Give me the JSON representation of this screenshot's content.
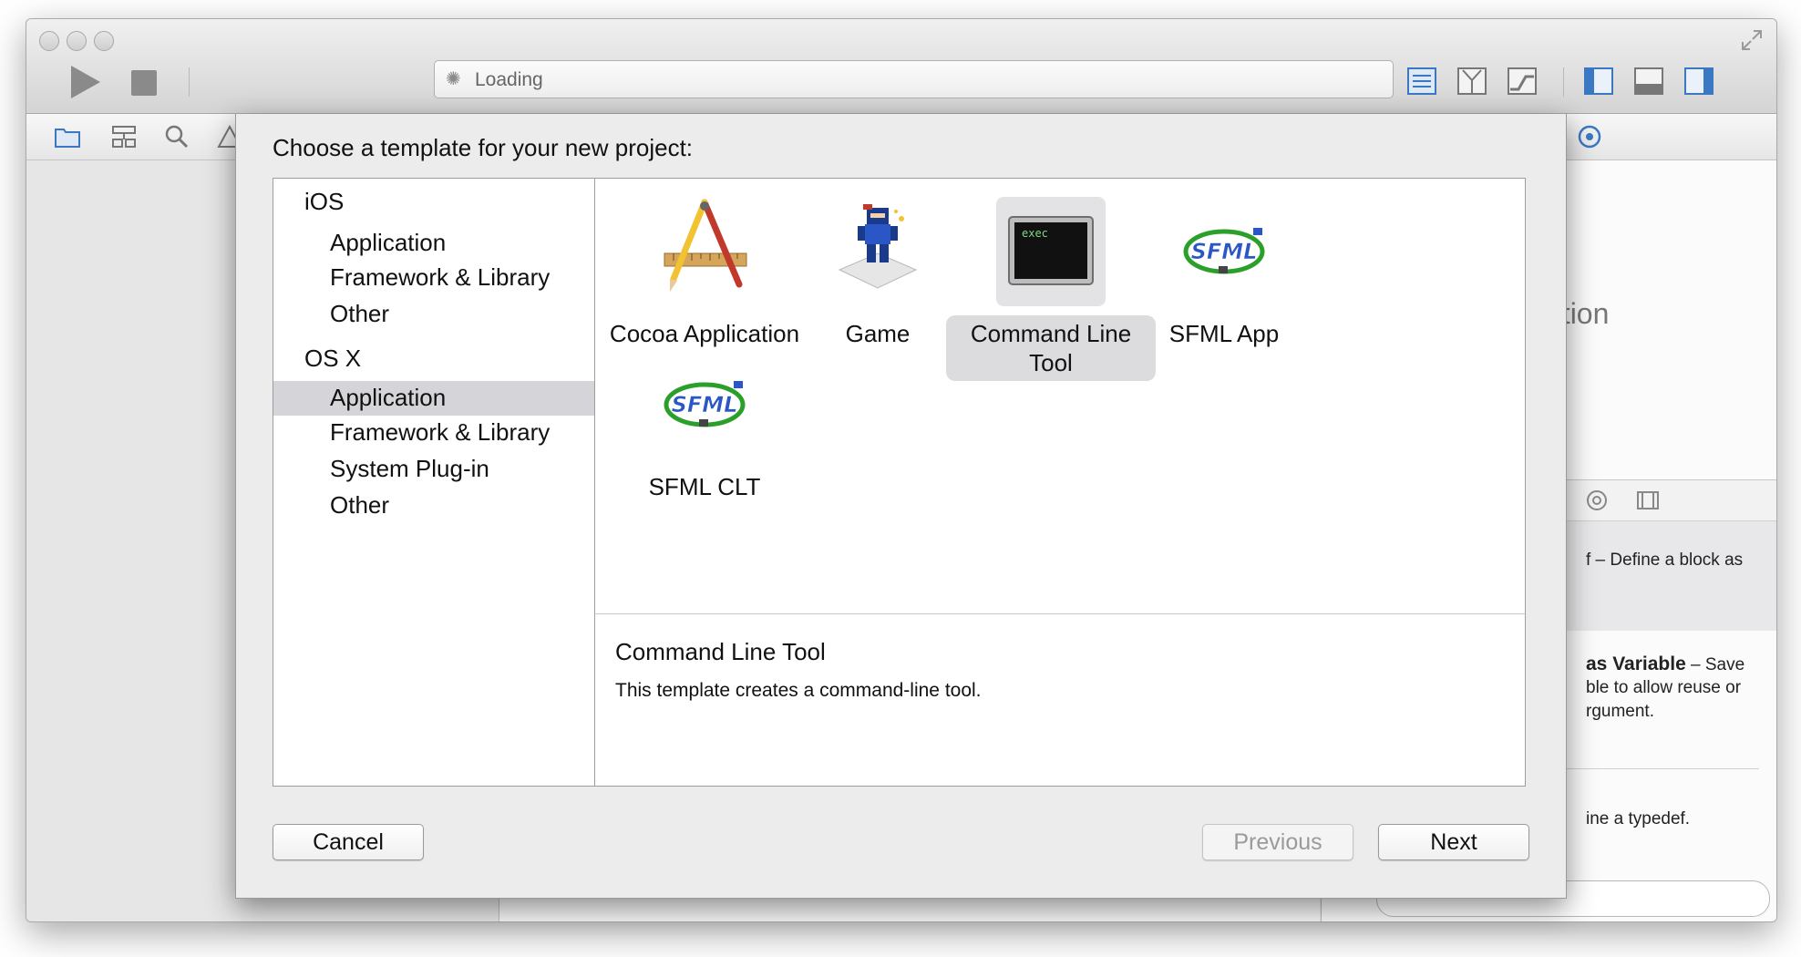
{
  "toolbar": {
    "activity_text": "Loading"
  },
  "utility_pane": {
    "title_partial": "ection",
    "snippet1": "f – Define a block as",
    "snippet2_bold": "as Variable",
    "snippet2_rest": " – Save",
    "snippet2_line2": "ble to allow reuse or",
    "snippet2_line3": "rgument.",
    "snippet3": "ine a typedef."
  },
  "sheet": {
    "title": "Choose a template for your new project:",
    "categories": [
      {
        "group": "iOS",
        "items": [
          "Application",
          "Framework & Library",
          "Other"
        ]
      },
      {
        "group": "OS X",
        "items": [
          "Application",
          "Framework & Library",
          "System Plug-in",
          "Other"
        ]
      }
    ],
    "selected_category": "OS X > Application",
    "templates": [
      {
        "label": "Cocoa Application",
        "icon": "cocoa-app-icon"
      },
      {
        "label": "Game",
        "icon": "game-ninja-icon"
      },
      {
        "label": "Command Line Tool",
        "icon": "terminal-exec-icon"
      },
      {
        "label": "SFML App",
        "icon": "sfml-icon"
      },
      {
        "label": "SFML CLT",
        "icon": "sfml-icon"
      }
    ],
    "terminal_icon_text": "exec",
    "sfml_icon_text": "SFML",
    "selected_template": "Command Line Tool",
    "description": {
      "title": "Command Line Tool",
      "text": "This template creates a command-line tool."
    },
    "buttons": {
      "cancel": "Cancel",
      "previous": "Previous",
      "next": "Next"
    }
  }
}
